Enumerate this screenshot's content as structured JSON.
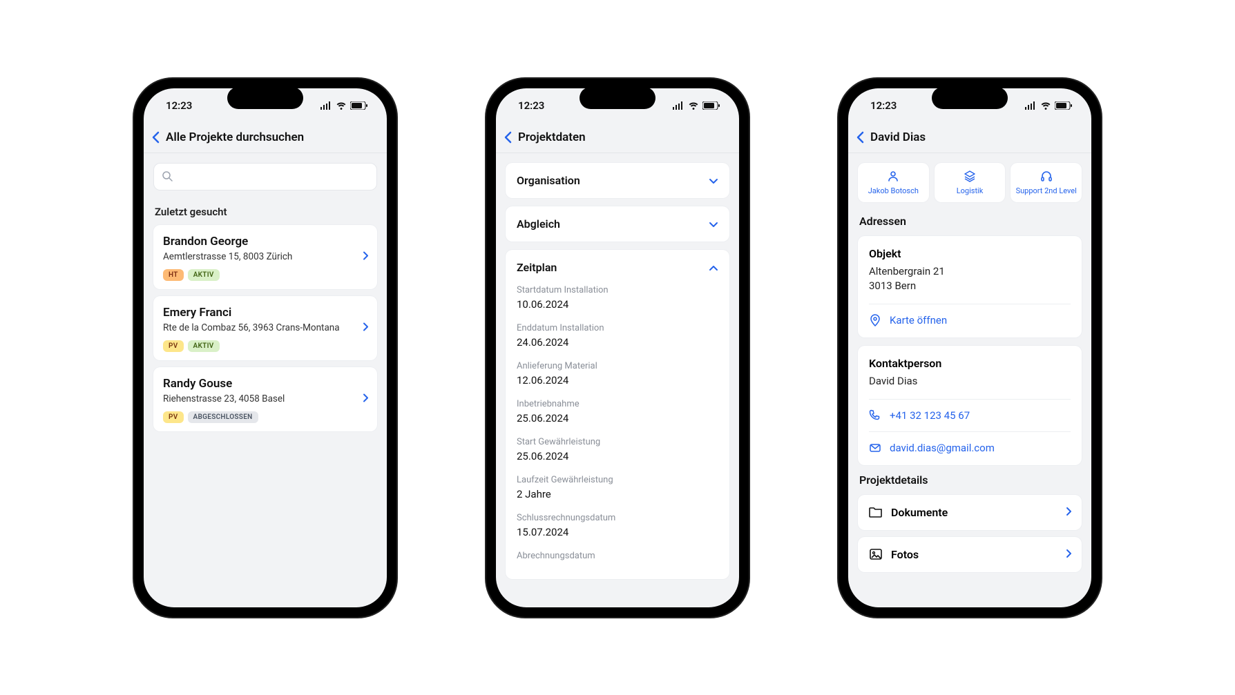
{
  "status": {
    "time": "12:23"
  },
  "screen1": {
    "nav_title": "Alle Projekte durchsuchen",
    "recent_label": "Zuletzt gesucht",
    "items": [
      {
        "name": "Brandon George",
        "addr": "Aemtlerstrasse 15, 8003 Zürich",
        "tag": "HT",
        "status": "AKTIV"
      },
      {
        "name": "Emery Franci",
        "addr": "Rte de la Combaz 56, 3963 Crans-Montana",
        "tag": "PV",
        "status": "AKTIV"
      },
      {
        "name": "Randy Gouse",
        "addr": "Riehenstrasse 23, 4058 Basel",
        "tag": "PV",
        "status": "ABGESCHLOSSEN"
      }
    ]
  },
  "screen2": {
    "nav_title": "Projektdaten",
    "sections": {
      "organisation": "Organisation",
      "abgleich": "Abgleich",
      "zeitplan": "Zeitplan"
    },
    "fields": [
      {
        "label": "Startdatum Installation",
        "value": "10.06.2024"
      },
      {
        "label": "Enddatum Installation",
        "value": "24.06.2024"
      },
      {
        "label": "Anlieferung Material",
        "value": "12.06.2024"
      },
      {
        "label": "Inbetriebnahme",
        "value": "25.06.2024"
      },
      {
        "label": "Start Gewährleistung",
        "value": "25.06.2024"
      },
      {
        "label": "Laufzeit Gewährleistung",
        "value": "2 Jahre"
      },
      {
        "label": "Schlussrechnungsdatum",
        "value": "15.07.2024"
      },
      {
        "label": "Abrechnungsdatum",
        "value": ""
      }
    ]
  },
  "screen3": {
    "nav_title": "David Dias",
    "chips": [
      {
        "label": "Jakob Botosch"
      },
      {
        "label": "Logistik"
      },
      {
        "label": "Support 2nd Level"
      }
    ],
    "addresses_label": "Adressen",
    "object": {
      "title": "Objekt",
      "line1": "Altenbergrain 21",
      "line2": "3013 Bern",
      "map_label": "Karte öffnen"
    },
    "contact": {
      "title": "Kontaktperson",
      "name": "David Dias",
      "phone": "+41 32 123 45 67",
      "email": "david.dias@gmail.com"
    },
    "details_label": "Projektdetails",
    "details": [
      {
        "label": "Dokumente"
      },
      {
        "label": "Fotos"
      }
    ]
  }
}
